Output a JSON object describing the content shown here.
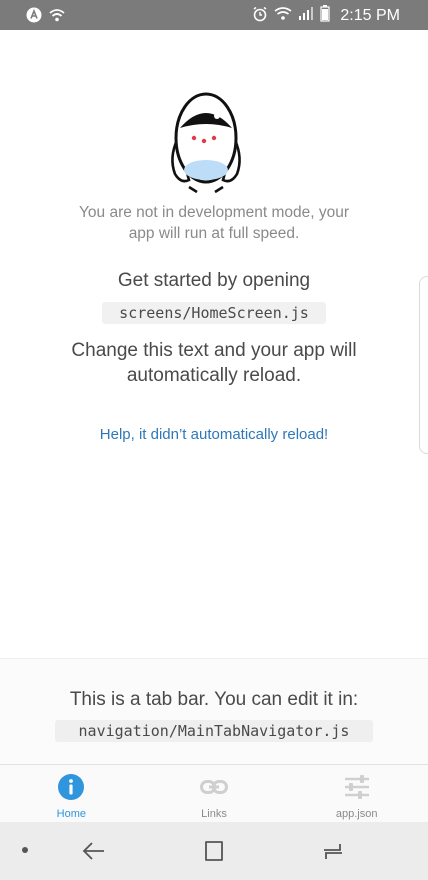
{
  "status_bar": {
    "time": "2:15 PM",
    "left_icons": [
      "app-a-icon",
      "wifi-call-icon"
    ],
    "right_icons": [
      "alarm-icon",
      "wifi-icon",
      "signal-icon",
      "battery-icon"
    ]
  },
  "main": {
    "dev_mode_notice": "You are not in development mode, your app will run at full speed.",
    "get_started": "Get started by opening",
    "file_path": "screens/HomeScreen.js",
    "change_text": "Change this text and your app will automatically reload.",
    "help_link": "Help, it didn’t automatically reload!"
  },
  "tab_bar_info": {
    "text": "This is a tab bar. You can edit it in:",
    "file_path": "navigation/MainTabNavigator.js"
  },
  "tabs": [
    {
      "label": "Home",
      "icon": "info-icon",
      "active": true
    },
    {
      "label": "Links",
      "icon": "link-icon",
      "active": false
    },
    {
      "label": "app.json",
      "icon": "sliders-icon",
      "active": false
    }
  ],
  "colors": {
    "active_tab": "#2f95dc",
    "link": "#2e78b7",
    "status_bar": "#7b7b7b"
  }
}
